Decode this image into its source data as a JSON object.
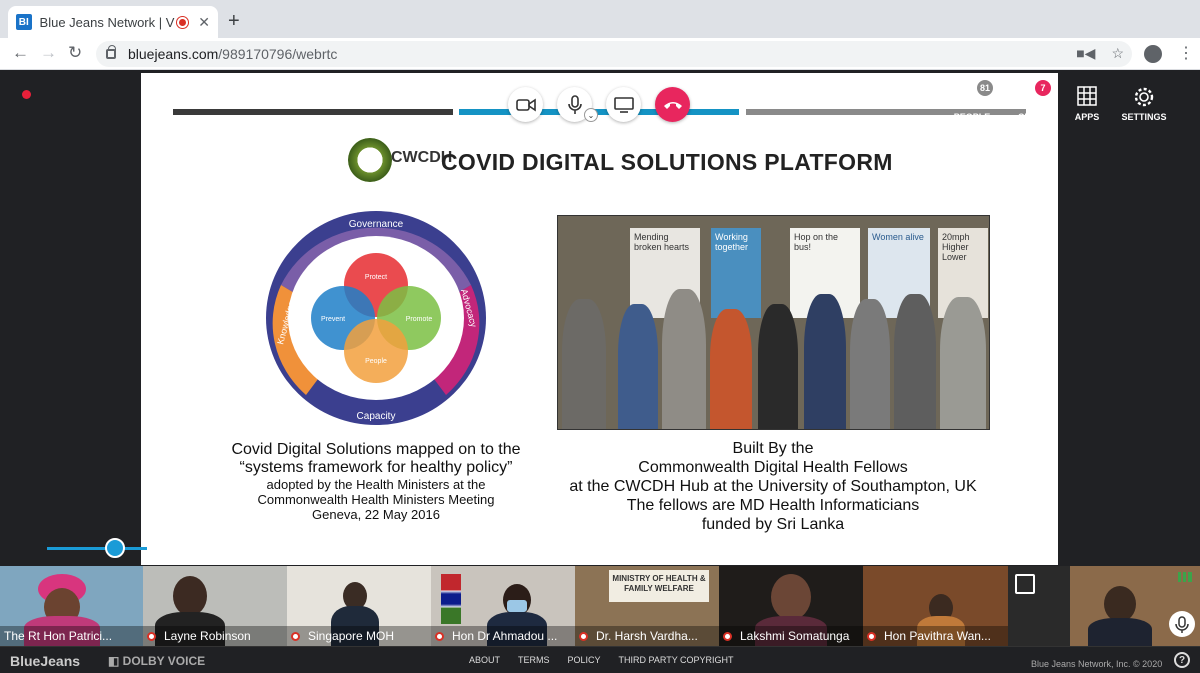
{
  "browser": {
    "tab_title": "Blue Jeans Network | Video",
    "favicon_text": "BI",
    "url_host": "bluejeans.com",
    "url_path": "/989170796/webrtc"
  },
  "toolbar": {
    "people_label": "PEOPLE",
    "people_count": "81",
    "chat_label": "CHAT",
    "chat_count": "7",
    "apps_label": "APPS",
    "settings_label": "SETTINGS"
  },
  "slide": {
    "logo_text": "CWCDH",
    "title": "COVID DIGITAL SOLUTIONS PLATFORM",
    "diagram": {
      "ring_top": "Governance",
      "ring_right": "Advocacy",
      "ring_bottom": "Capacity",
      "ring_left": "Knowledge",
      "circle_top": "Protect",
      "circle_left": "Prevent",
      "circle_right": "Promote",
      "circle_bottom": "People"
    },
    "caption_left": {
      "line1": "Covid Digital Solutions mapped on to the",
      "line2": "“systems framework for healthy policy”",
      "line3": "adopted by the Health Ministers at the",
      "line4": "Commonwealth Health Ministers Meeting",
      "line5": "Geneva, 22 May 2016"
    },
    "caption_right": {
      "line1": "Built By the",
      "line2": "Commonwealth Digital Health Fellows",
      "line3": "at the CWCDH Hub at the University of Southampton, UK",
      "line4": "The fellows are MD Health Informaticians",
      "line5": "funded by Sri Lanka"
    },
    "photo_banners": [
      "Mending broken hearts",
      "Working together",
      "Hop on the bus!",
      "Women alive",
      "20mph Higher Lower"
    ]
  },
  "participants": [
    {
      "name": "The Rt Hon Patrici..."
    },
    {
      "name": "Layne Robinson"
    },
    {
      "name": "Singapore MOH"
    },
    {
      "name": "Hon Dr Ahmadou ..."
    },
    {
      "name": "Dr. Harsh Vardha..."
    },
    {
      "name": "Lakshmi Somatunga"
    },
    {
      "name": "Hon Pavithra Wan..."
    }
  ],
  "thumb_signs": {
    "ministry": "MINISTRY OF HEALTH & FAMILY WELFARE"
  },
  "footer": {
    "brand": "BlueJeans",
    "dolby": "DOLBY VOICE",
    "links": [
      "ABOUT",
      "TERMS",
      "POLICY",
      "THIRD PARTY COPYRIGHT"
    ],
    "copyright": "Blue Jeans Network, Inc. © 2020",
    "help": "?"
  },
  "colors": {
    "accent_blue": "#1a9bd7",
    "hangup_red": "#e8265e",
    "badge_red": "#e8265e"
  }
}
